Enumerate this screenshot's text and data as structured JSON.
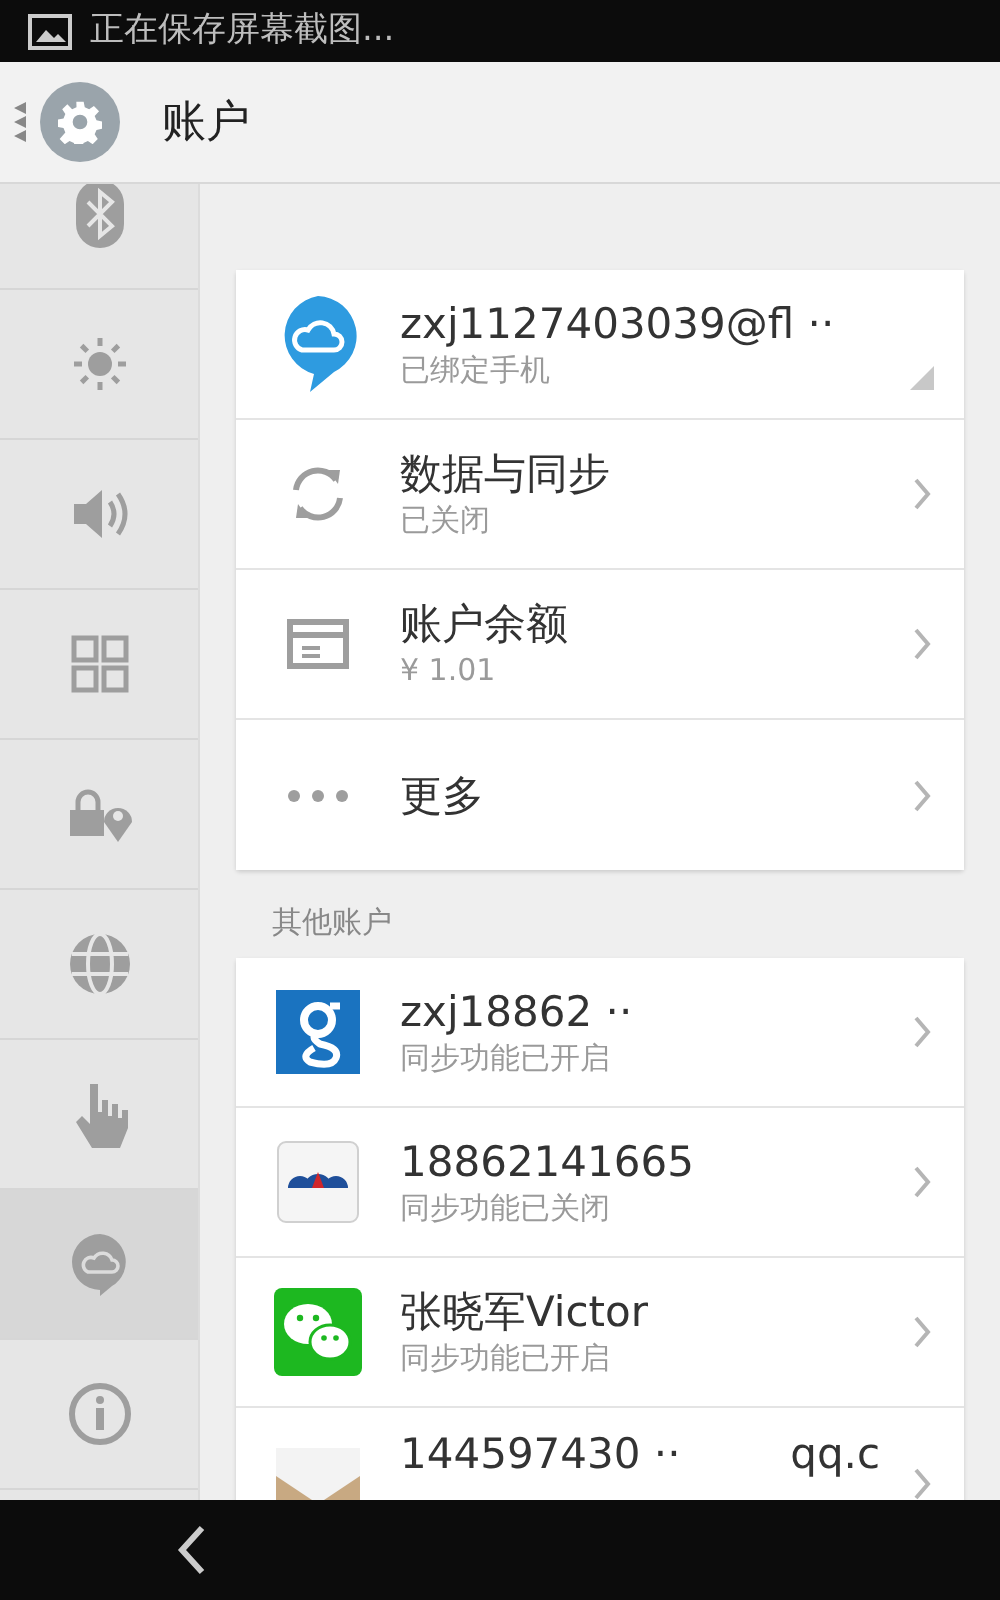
{
  "status_bar": {
    "notification": "正在保存屏幕截图..."
  },
  "header": {
    "title": "账户"
  },
  "sidebar": {
    "items": [
      {
        "kind": "bluetooth",
        "selected": false
      },
      {
        "kind": "brightness",
        "selected": false
      },
      {
        "kind": "sound",
        "selected": false
      },
      {
        "kind": "apps",
        "selected": false
      },
      {
        "kind": "security",
        "selected": false
      },
      {
        "kind": "globe",
        "selected": false
      },
      {
        "kind": "gesture",
        "selected": false
      },
      {
        "kind": "cloud",
        "selected": true
      },
      {
        "kind": "info",
        "selected": false
      }
    ]
  },
  "main_account": {
    "kind": "cloud",
    "title": "zxj1127403039@fl ··",
    "subtitle": "已绑定手机"
  },
  "settings": [
    {
      "kind": "sync",
      "title": "数据与同步",
      "subtitle": "已关闭"
    },
    {
      "kind": "balance",
      "title": "账户余额",
      "subtitle": "¥ 1.01"
    },
    {
      "kind": "more",
      "title": "更多"
    }
  ],
  "other_accounts": {
    "heading": "其他账户",
    "items": [
      {
        "kind": "google",
        "title": "zxj18862 ··",
        "subtitle": "同步功能已开启"
      },
      {
        "kind": "bank",
        "title": "18862141665",
        "subtitle": "同步功能已关闭"
      },
      {
        "kind": "wechat",
        "title": "张晓军Victor",
        "subtitle": "同步功能已开启"
      },
      {
        "kind": "mail",
        "title": "144597430 ··",
        "suffix": "qq.c"
      }
    ]
  }
}
